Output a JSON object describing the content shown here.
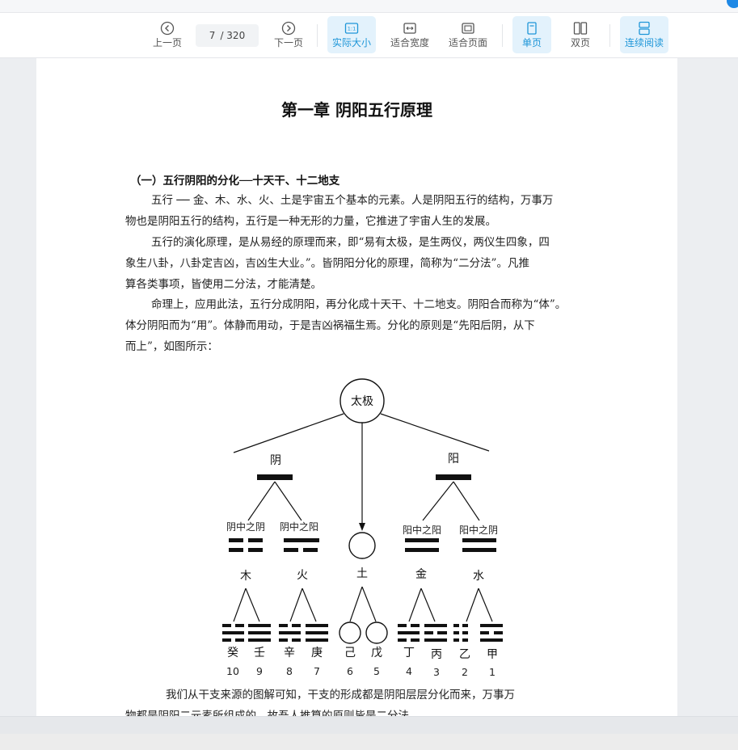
{
  "toolbar": {
    "prev_label": "上一页",
    "current_page": "7",
    "total_pages": "/ 320",
    "next_label": "下一页",
    "actual_size_label": "实际大小",
    "actual_size_icon_text": "1:1",
    "fit_width_label": "适合宽度",
    "fit_page_label": "适合页面",
    "single_page_label": "单页",
    "double_page_label": "双页",
    "continuous_label": "连续阅读"
  },
  "document": {
    "chapter_title": "第一章  阴阳五行原理",
    "section_title": "（一）五行阴阳的分化──十天干、十二地支",
    "paragraphs": [
      {
        "lines": [
          "五行 ── 金、木、水、火、土是宇宙五个基本的元素。人是阴阳五行的结构，万事万",
          "物也是阴阳五行的结构，五行是一种无形的力量，它推进了宇宙人生的发展。"
        ]
      },
      {
        "lines": [
          "五行的演化原理，是从易经的原理而来，即“易有太极，是生两仪，两仪生四象，四",
          "象生八卦，八卦定吉凶，吉凶生大业。”。皆阴阳分化的原理，简称为“二分法”。凡推",
          "算各类事项，皆使用二分法，才能清楚。"
        ]
      },
      {
        "lines": [
          "命理上，应用此法，五行分成阴阳，再分化成十天干、十二地支。阴阳合而称为“体”。",
          "体分阴阳而为“用”。体静而用动，于是吉凶祸福生焉。分化的原则是“先阳后阴，从下",
          "而上”，如图所示："
        ]
      },
      {
        "lines": [
          "我们从干支来源的图解可知，干支的形成都是阴阳层层分化而来，万事万",
          "物都是阴阳二元素所组成的。故吾人推算的原则皆是二分法。"
        ]
      }
    ]
  },
  "diagram": {
    "root": "太极",
    "yin": "阴",
    "yang": "阳",
    "sub_labels": [
      "阴中之阴",
      "阴中之阳",
      "阳中之阳",
      "阳中之阴"
    ],
    "elements": [
      "木",
      "火",
      "土",
      "金",
      "水"
    ],
    "stems": [
      "癸",
      "壬",
      "辛",
      "庚",
      "己",
      "戊",
      "丁",
      "丙",
      "乙",
      "甲"
    ],
    "numbers": [
      "10",
      "9",
      "8",
      "7",
      "6",
      "5",
      "4",
      "3",
      "2",
      "1"
    ]
  }
}
